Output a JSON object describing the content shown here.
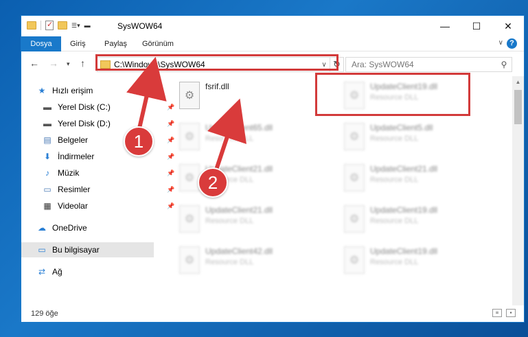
{
  "window": {
    "title": "SysWOW64"
  },
  "ribbon": {
    "tabs": [
      "Dosya",
      "Giriş",
      "Paylaş",
      "Görünüm"
    ]
  },
  "address": {
    "path": "C:\\Windows\\SysWOW64"
  },
  "search": {
    "placeholder": "Ara: SysWOW64"
  },
  "sidebar": {
    "items": [
      {
        "label": "Hızlı erişim",
        "icon": "star-icon"
      },
      {
        "label": "Yerel Disk (C:)",
        "icon": "drive-icon"
      },
      {
        "label": "Yerel Disk (D:)",
        "icon": "drive-icon"
      },
      {
        "label": "Belgeler",
        "icon": "documents-icon"
      },
      {
        "label": "İndirmeler",
        "icon": "download-icon"
      },
      {
        "label": "Müzik",
        "icon": "music-icon"
      },
      {
        "label": "Resimler",
        "icon": "pictures-icon"
      },
      {
        "label": "Videolar",
        "icon": "videos-icon"
      },
      {
        "label": "OneDrive",
        "icon": "cloud-icon"
      },
      {
        "label": "Bu bilgisayar",
        "icon": "computer-icon"
      },
      {
        "label": "Ağ",
        "icon": "network-icon"
      }
    ]
  },
  "files": [
    {
      "name": "fsrif.dll",
      "type": ""
    },
    {
      "name": "UpdateClient19.dll",
      "type": "Resource DLL"
    },
    {
      "name": "UpdateClient65.dll",
      "type": "Resource DLL"
    },
    {
      "name": "UpdateClient5.dll",
      "type": "Resource DLL"
    },
    {
      "name": "UpdateClient21.dll",
      "type": "Resource DLL"
    },
    {
      "name": "UpdateClient21.dll",
      "type": "Resource DLL"
    },
    {
      "name": "UpdateClient21.dll",
      "type": "Resource DLL"
    },
    {
      "name": "UpdateClient19.dll",
      "type": "Resource DLL"
    },
    {
      "name": "UpdateClient42.dll",
      "type": "Resource DLL"
    },
    {
      "name": "UpdateClient19.dll",
      "type": "Resource DLL"
    }
  ],
  "status": {
    "count": "129 öğe"
  },
  "annotations": {
    "step1": "1",
    "step2": "2",
    "color": "#d93b3b"
  }
}
